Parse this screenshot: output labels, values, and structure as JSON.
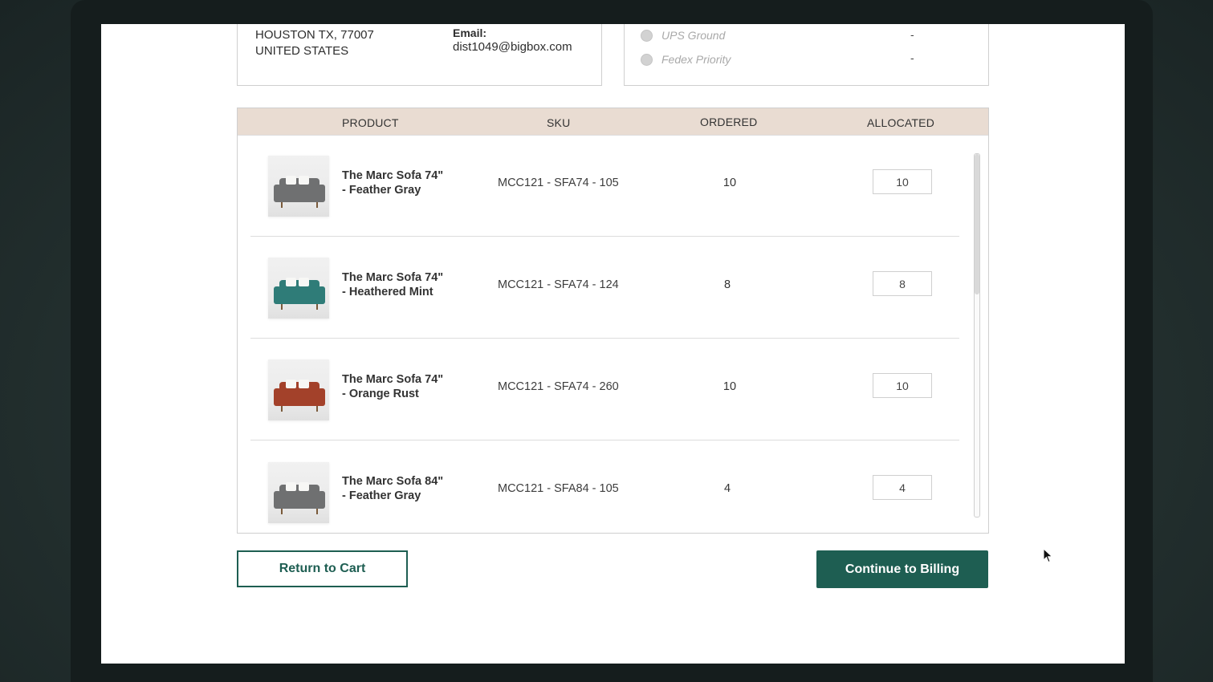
{
  "address": {
    "city_line": "HOUSTON TX, 77007",
    "country": "UNITED STATES",
    "email_label": "Email:",
    "email": "dist1049@bigbox.com"
  },
  "shipping": [
    {
      "label": "UPS Ground",
      "price": "-"
    },
    {
      "label": "Fedex Priority",
      "price": "-"
    }
  ],
  "table": {
    "headers": {
      "product": "PRODUCT",
      "sku": "SKU",
      "ordered": "ORDERED",
      "allocated": "ALLOCATED"
    },
    "rows": [
      {
        "name_line1": "The Marc Sofa 74\"",
        "name_line2": "- Feather Gray",
        "sku": "MCC121 - SFA74 - 105",
        "ordered": "10",
        "allocated": "10",
        "sofa_color": "#6f7071"
      },
      {
        "name_line1": "The Marc Sofa 74\"",
        "name_line2": "- Heathered Mint",
        "sku": "MCC121 - SFA74 - 124",
        "ordered": "8",
        "allocated": "8",
        "sofa_color": "#2f7c78"
      },
      {
        "name_line1": "The Marc Sofa 74\"",
        "name_line2": "- Orange Rust",
        "sku": "MCC121 - SFA74 - 260",
        "ordered": "10",
        "allocated": "10",
        "sofa_color": "#a3412a"
      },
      {
        "name_line1": "The Marc Sofa 84\"",
        "name_line2": "- Feather Gray",
        "sku": "MCC121 - SFA84 - 105",
        "ordered": "4",
        "allocated": "4",
        "sofa_color": "#6f7071"
      }
    ]
  },
  "buttons": {
    "return": "Return to Cart",
    "continue": "Continue to Billing"
  },
  "colors": {
    "brand_green": "#1e5e52",
    "table_header_bg": "#e9dcd2"
  }
}
